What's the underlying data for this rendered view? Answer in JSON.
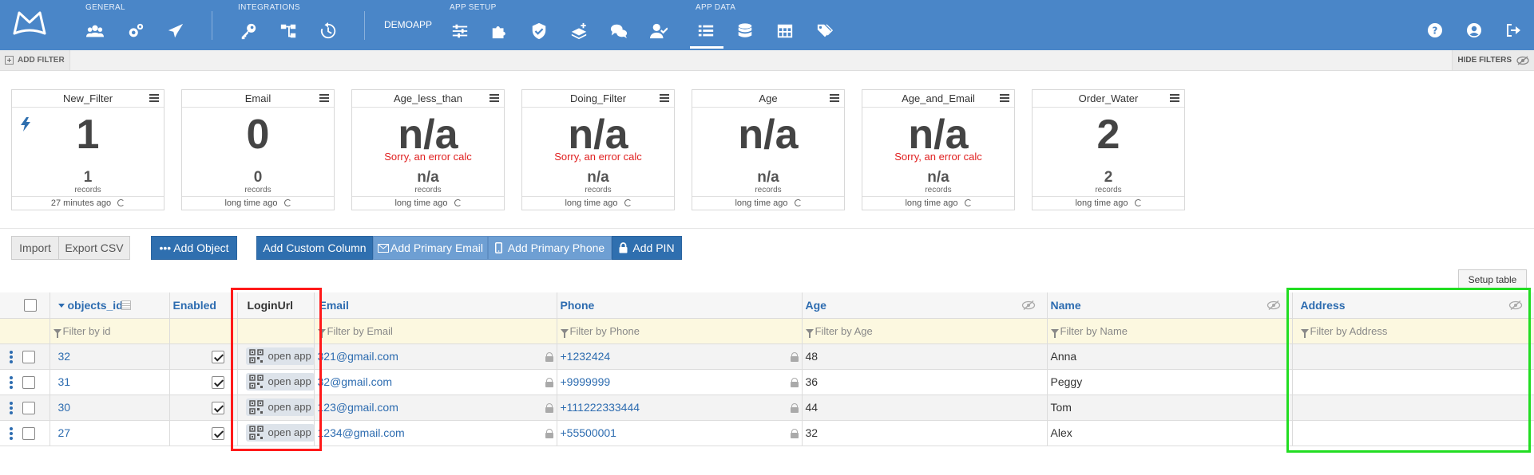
{
  "topbar": {
    "groups": {
      "general": "GENERAL",
      "integrations": "INTEGRATIONS",
      "app_setup": "APP SETUP",
      "app_data": "APP DATA"
    },
    "app_name": "DEMOAPP"
  },
  "filterbar": {
    "add_filter": "ADD FILTER",
    "hide_filters": "HIDE FILTERS"
  },
  "cards": [
    {
      "title": "New_Filter",
      "big": "1",
      "error": "",
      "small": "1",
      "records": "records",
      "time": "27 minutes ago",
      "bolt": true
    },
    {
      "title": "Email",
      "big": "0",
      "error": "",
      "small": "0",
      "records": "records",
      "time": "long time ago"
    },
    {
      "title": "Age_less_than",
      "big": "n/a",
      "error": "Sorry, an error calc",
      "small": "n/a",
      "records": "records",
      "time": "long time ago"
    },
    {
      "title": "Doing_Filter",
      "big": "n/a",
      "error": "Sorry, an error calc",
      "small": "n/a",
      "records": "records",
      "time": "long time ago"
    },
    {
      "title": "Age",
      "big": "n/a",
      "error": "",
      "small": "n/a",
      "records": "records",
      "time": "long time ago"
    },
    {
      "title": "Age_and_Email",
      "big": "n/a",
      "error": "Sorry, an error calc",
      "small": "n/a",
      "records": "records",
      "time": "long time ago"
    },
    {
      "title": "Order_Water",
      "big": "2",
      "error": "",
      "small": "2",
      "records": "records",
      "time": "long time ago"
    }
  ],
  "actions": {
    "import": "Import",
    "export": "Export CSV",
    "add_object": "••• Add Object",
    "add_custom_column": "Add Custom Column",
    "add_primary_email": "Add Primary Email",
    "add_primary_phone": "Add Primary Phone",
    "add_pin": "Add PIN",
    "setup_table": "Setup table"
  },
  "table": {
    "columns": {
      "id": "objects_id",
      "enabled": "Enabled",
      "loginurl": "LoginUrl",
      "email": "Email",
      "phone": "Phone",
      "age": "Age",
      "name": "Name",
      "address": "Address"
    },
    "filters": {
      "id": "Filter by id",
      "email": "Filter by Email",
      "phone": "Filter by Phone",
      "age": "Filter by Age",
      "name": "Filter by Name",
      "address": "Filter by Address"
    },
    "open_app": "open app",
    "rows": [
      {
        "id": "32",
        "email": "321@gmail.com",
        "phone": "+1232424",
        "age": "48",
        "name": "Anna",
        "address": ""
      },
      {
        "id": "31",
        "email": "32@gmail.com",
        "phone": "+9999999",
        "age": "36",
        "name": "Peggy",
        "address": ""
      },
      {
        "id": "30",
        "email": "123@gmail.com",
        "phone": "+111222333444",
        "age": "44",
        "name": "Tom",
        "address": ""
      },
      {
        "id": "27",
        "email": "1234@gmail.com",
        "phone": "+55500001",
        "age": "32",
        "name": "Alex",
        "address": ""
      }
    ]
  }
}
